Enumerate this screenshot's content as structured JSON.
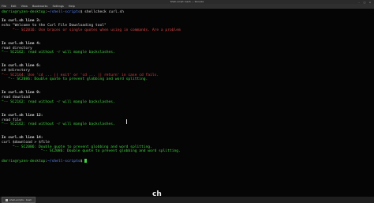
{
  "window": {
    "title": "Shell-script: bash — Konsole"
  },
  "menubar": [
    "File",
    "Edit",
    "View",
    "Bookmarks",
    "Settings",
    "Help"
  ],
  "terminal": {
    "lines": [
      {
        "segments": [
          {
            "text": "dmrrix@ryzen-desktop",
            "cls": "green"
          },
          {
            "text": ":",
            "cls": ""
          },
          {
            "text": "~/shell-scripts",
            "cls": "blue"
          },
          {
            "text": "$ shellcheck curl.sh",
            "cls": ""
          }
        ]
      },
      {
        "segments": []
      },
      {
        "segments": [
          {
            "text": "In curl.sh line 3:",
            "cls": "bold"
          }
        ]
      },
      {
        "segments": [
          {
            "text": "echo \"Welcome to the Curl File Downloading tool\"",
            "cls": ""
          }
        ]
      },
      {
        "segments": [
          {
            "text": "     ^-- SC2016: Use braces or single quotes when using in commands. Are a problem",
            "cls": "red"
          }
        ]
      },
      {
        "segments": []
      },
      {
        "segments": []
      },
      {
        "segments": [
          {
            "text": "In curl.sh line 4:",
            "cls": "bold"
          }
        ]
      },
      {
        "segments": [
          {
            "text": "read directory",
            "cls": ""
          }
        ]
      },
      {
        "segments": [
          {
            "text": "^-- SC2162: read without -r will mangle backslashes.",
            "cls": "green"
          }
        ]
      },
      {
        "segments": []
      },
      {
        "segments": []
      },
      {
        "segments": [
          {
            "text": "In curl.sh line 6:",
            "cls": "bold"
          }
        ]
      },
      {
        "segments": [
          {
            "text": "cd $directory",
            "cls": ""
          }
        ]
      },
      {
        "segments": [
          {
            "text": "^-- SC2164: Use 'cd ... || exit' or 'cd ... || return' in case cd fails.",
            "cls": "red"
          }
        ]
      },
      {
        "segments": [
          {
            "text": "   ^-- SC2086: Double quote to prevent globbing and word splitting.",
            "cls": "green"
          }
        ]
      },
      {
        "segments": []
      },
      {
        "segments": []
      },
      {
        "segments": [
          {
            "text": "In curl.sh line 9:",
            "cls": "bold"
          }
        ]
      },
      {
        "segments": [
          {
            "text": "read download",
            "cls": ""
          }
        ]
      },
      {
        "segments": [
          {
            "text": "^-- SC2162: read without -r will mangle backslashes.",
            "cls": "green"
          }
        ]
      },
      {
        "segments": []
      },
      {
        "segments": []
      },
      {
        "segments": [
          {
            "text": "In curl.sh line 12:",
            "cls": "bold"
          }
        ]
      },
      {
        "segments": [
          {
            "text": "read file",
            "cls": ""
          }
        ]
      },
      {
        "segments": [
          {
            "text": "^-- SC2162: read without -r will mangle backslashes.",
            "cls": "green"
          }
        ]
      },
      {
        "segments": []
      },
      {
        "segments": []
      },
      {
        "segments": [
          {
            "text": "In curl.sh line 14:",
            "cls": "bold"
          }
        ]
      },
      {
        "segments": [
          {
            "text": "curl $download > $file",
            "cls": ""
          }
        ]
      },
      {
        "segments": [
          {
            "text": "     ^-- SC2086: Double quote to prevent globbing and word splitting.",
            "cls": "green"
          }
        ]
      },
      {
        "segments": [
          {
            "text": "                  ^-- SC2086: Double quote to prevent globbing and word splitting.",
            "cls": "green"
          }
        ]
      },
      {
        "segments": []
      },
      {
        "segments": [
          {
            "text": "dmrrix@ryzen-desktop",
            "cls": "green"
          },
          {
            "text": ":",
            "cls": ""
          },
          {
            "text": "~/shell-scripts",
            "cls": "blue"
          },
          {
            "text": "$ ",
            "cls": ""
          }
        ],
        "cursor": true
      }
    ]
  },
  "taskbar": {
    "task_label": "shell-scripts : bash"
  },
  "overlay_text": "ch"
}
